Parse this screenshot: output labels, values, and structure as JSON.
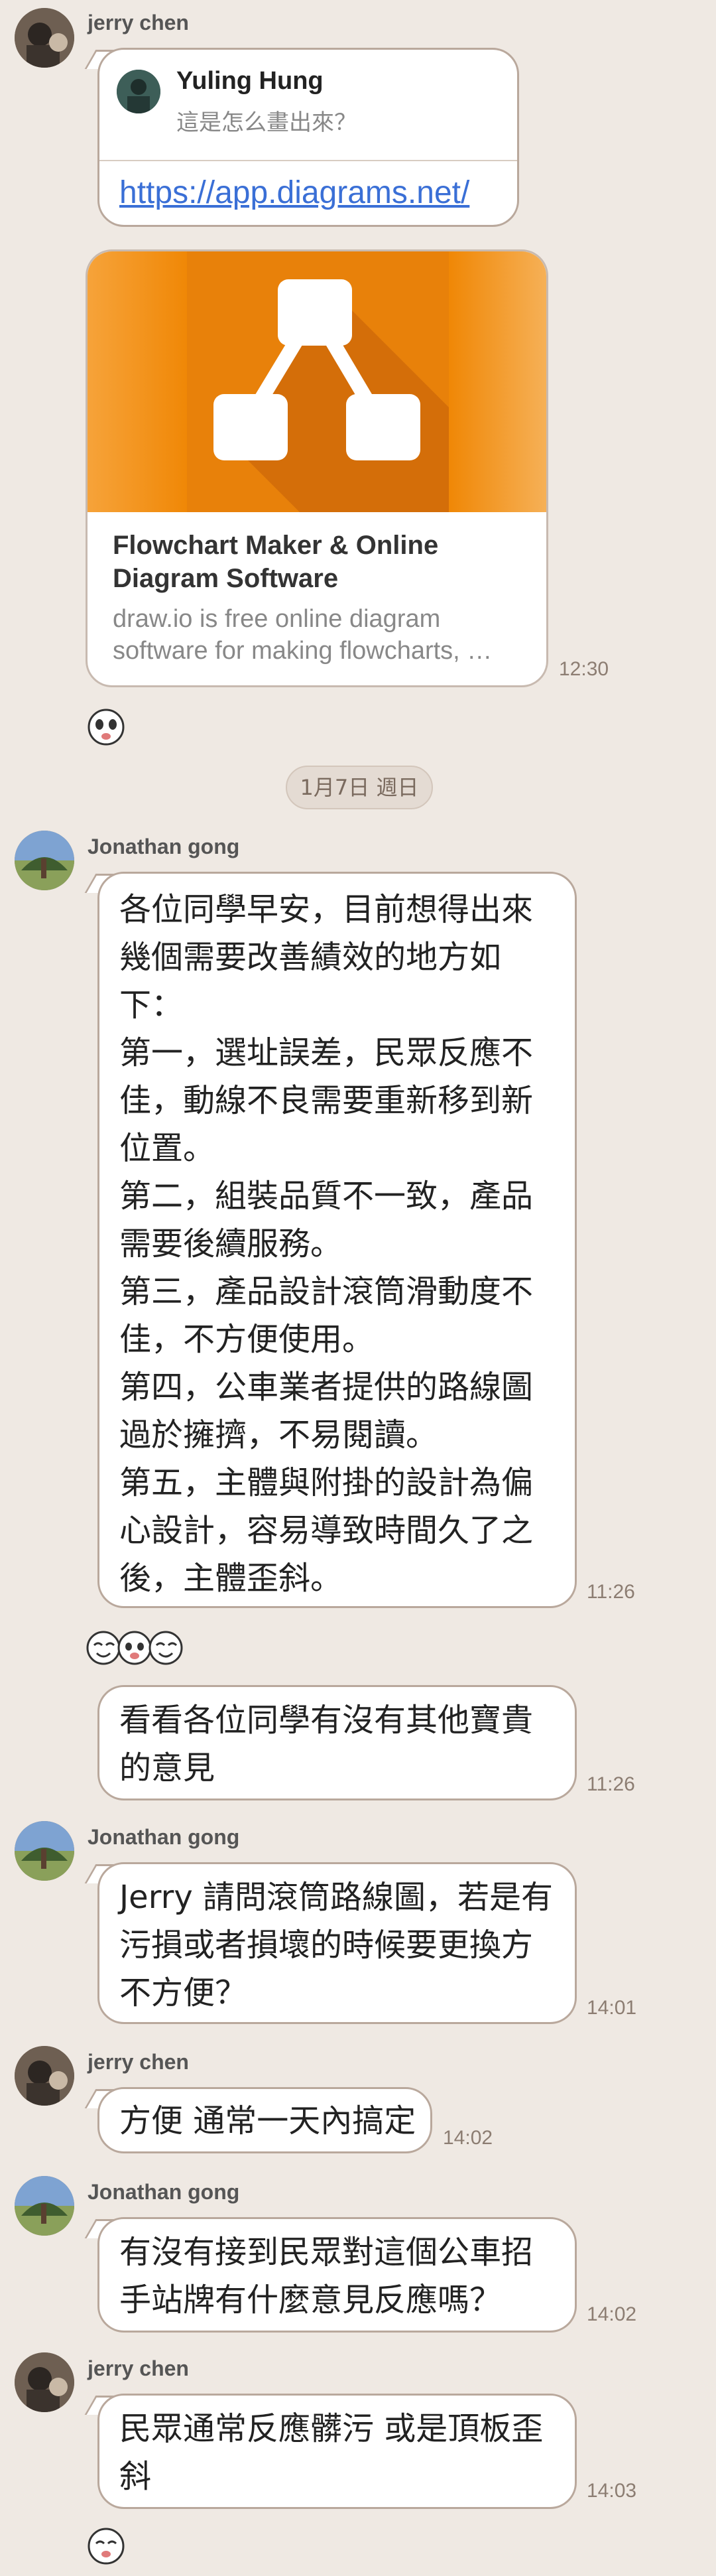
{
  "messages": {
    "m1": {
      "sender": "jerry chen",
      "quote_name": "Yuling Hung",
      "quote_text": "這是怎么畫出來？",
      "link": "https://app.diagrams.net/",
      "card_title": "Flowchart Maker & Online Diagram Software",
      "card_desc": "draw.io is free online diagram software for making flowcharts, …",
      "time": "12:30"
    },
    "date_separator": "1月7日 週日",
    "m2": {
      "sender": "Jonathan gong",
      "text": "各位同學早安，目前想得出來\n幾個需要改善績效的地方如\n下：\n第一，選址誤差，民眾反應不\n佳，動線不良需要重新移到新\n位置。\n第二，組裝品質不一致，產品\n需要後續服務。\n第三，產品設計滾筒滑動度不\n佳，不方便使用。\n第四，公車業者提供的路線圖\n過於擁擠，不易閱讀。\n第五，主體與附掛的設計為偏\n心設計，容易導致時間久了之\n後，主體歪斜。",
      "time": "11:26"
    },
    "m3": {
      "text": "看看各位同學有沒有其他寶貴\n的意見",
      "time": "11:26"
    },
    "m4": {
      "sender": "Jonathan gong",
      "text": "Jerry 請問滾筒路線圖，若是有\n污損或者損壞的時候要更換方\n不方便？",
      "time": "14:01"
    },
    "m5": {
      "sender": "jerry chen",
      "text": "方便 通常一天內搞定",
      "time": "14:02"
    },
    "m6": {
      "sender": "Jonathan gong",
      "text": "有沒有接到民眾對這個公車招\n手站牌有什麼意見反應嗎？",
      "time": "14:02"
    },
    "m7": {
      "sender": "jerry chen",
      "text": "民眾通常反應髒污 或是頂板歪\n斜",
      "time": "14:03"
    }
  },
  "colors": {
    "background": "#efe9e3",
    "bubble_border": "#b9a89c",
    "link": "#3a6fd6",
    "drawio_orange": "#f08705"
  },
  "icons": {
    "sticker_1": "panda-face-sticker",
    "sticker_2": "three-panda-faces-sticker",
    "sticker_3": "panda-face-sticker",
    "drawio_logo": "flowchart-icon"
  }
}
